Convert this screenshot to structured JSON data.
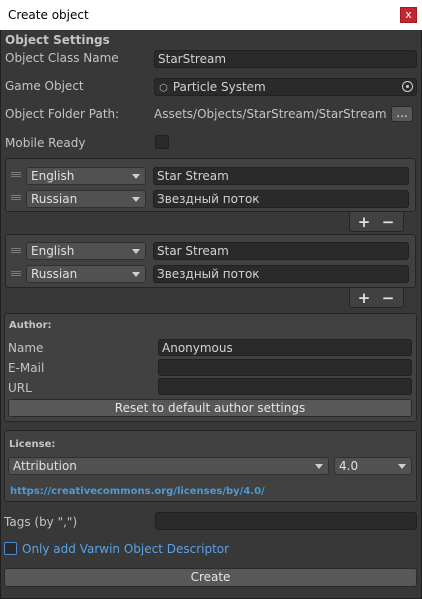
{
  "window": {
    "title": "Create object",
    "close": "x"
  },
  "object_settings": {
    "header": "Object Settings",
    "class_name_label": "Object Class Name",
    "class_name_value": "StarStream",
    "game_object_label": "Game Object",
    "game_object_value": "Particle System",
    "folder_label": "Object Folder Path:",
    "folder_value": "Assets/Objects/StarStream/StarStream.pref",
    "folder_button": "...",
    "mobile_label": "Mobile Ready"
  },
  "name_lists": [
    {
      "rows": [
        {
          "language": "English",
          "text": "Star Stream"
        },
        {
          "language": "Russian",
          "text": "Звездный поток"
        }
      ]
    },
    {
      "rows": [
        {
          "language": "English",
          "text": "Star Stream"
        },
        {
          "language": "Russian",
          "text": "Звездный поток"
        }
      ]
    }
  ],
  "list_controls": {
    "add": "+",
    "remove": "−"
  },
  "author": {
    "header": "Author:",
    "name_label": "Name",
    "name_value": "Anonymous",
    "email_label": "E-Mail",
    "email_value": "",
    "url_label": "URL",
    "url_value": "",
    "reset_button": "Reset to default author settings"
  },
  "license": {
    "header": "License:",
    "type": "Attribution",
    "version": "4.0",
    "link": "https://creativecommons.org/licenses/by/4.0/"
  },
  "tags": {
    "label": "Tags (by \",\")",
    "value": ""
  },
  "varwin_option": {
    "label": "Only add Varwin Object Descriptor"
  },
  "create_button": "Create",
  "colors": {
    "background": "#383838",
    "field": "#2a2a2a",
    "link": "#4c9bd6",
    "close": "#c3262f"
  }
}
